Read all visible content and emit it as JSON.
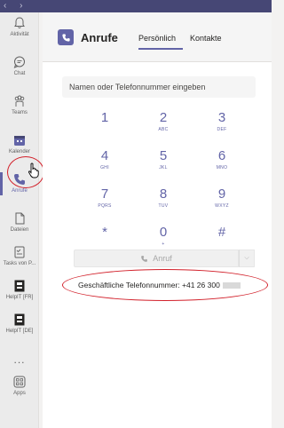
{
  "rail": {
    "items": [
      {
        "label": "Aktivität",
        "icon": "bell-icon"
      },
      {
        "label": "Chat",
        "icon": "chat-icon"
      },
      {
        "label": "Teams",
        "icon": "teams-icon"
      },
      {
        "label": "Kalender",
        "icon": "calendar-icon"
      },
      {
        "label": "Anrufe",
        "icon": "phone-icon"
      },
      {
        "label": "Dateien",
        "icon": "file-icon"
      },
      {
        "label": "Tasks von P...",
        "icon": "tasks-icon"
      },
      {
        "label": "HelpIT [FR]",
        "icon": "helpit-icon"
      },
      {
        "label": "HelpIT [DE]",
        "icon": "helpit-icon"
      },
      {
        "label": "Apps",
        "icon": "apps-icon"
      }
    ],
    "more": "..."
  },
  "header": {
    "title": "Anrufe",
    "tabs": [
      "Persönlich",
      "Kontakte"
    ]
  },
  "search": {
    "placeholder": "Namen oder Telefonnummer eingeben"
  },
  "dialpad": [
    {
      "digit": "1",
      "letters": ""
    },
    {
      "digit": "2",
      "letters": "ABC"
    },
    {
      "digit": "3",
      "letters": "DEF"
    },
    {
      "digit": "4",
      "letters": "GHI"
    },
    {
      "digit": "5",
      "letters": "JKL"
    },
    {
      "digit": "6",
      "letters": "MNO"
    },
    {
      "digit": "7",
      "letters": "PQRS"
    },
    {
      "digit": "8",
      "letters": "TUV"
    },
    {
      "digit": "9",
      "letters": "WXYZ"
    },
    {
      "digit": "*",
      "letters": ""
    },
    {
      "digit": "0",
      "letters": "+"
    },
    {
      "digit": "#",
      "letters": ""
    }
  ],
  "call": {
    "label": "Anruf"
  },
  "business": {
    "text": "Geschäftliche Telefonnummer: +41 26 300"
  },
  "colors": {
    "accent": "#6264a7",
    "annotation": "#d2202a"
  }
}
